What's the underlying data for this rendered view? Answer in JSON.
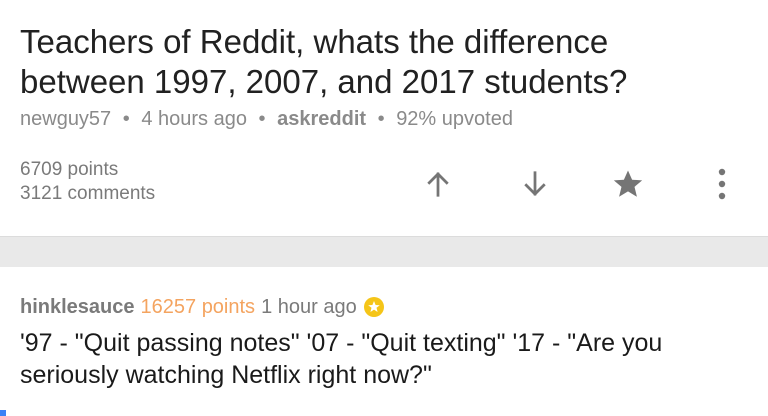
{
  "post": {
    "title": "Teachers of Reddit, whats the difference between 1997, 2007, and 2017 students?",
    "author": "newguy57",
    "time": "4 hours ago",
    "subreddit": "askreddit",
    "upvoted": "92% upvoted",
    "separator": "•",
    "points": "6709 points",
    "comments": "3121 comments"
  },
  "icons": {
    "upvote": "arrow-up-icon",
    "downvote": "arrow-down-icon",
    "save": "star-icon",
    "more": "more-vertical-icon",
    "gold": "gold-star-badge-icon"
  },
  "colors": {
    "title": "#212121",
    "meta": "#8a8a8a",
    "points_accent": "#f4a460",
    "gold": "#f5c518",
    "icon": "#757575",
    "band": "#e9e9e9"
  },
  "comment": {
    "author": "hinklesauce",
    "points": "16257 points",
    "time": "1 hour ago",
    "body": "'97 - \"Quit passing notes\" '07 - \"Quit texting\" '17 - \"Are you seriously watching Netflix right now?\""
  }
}
